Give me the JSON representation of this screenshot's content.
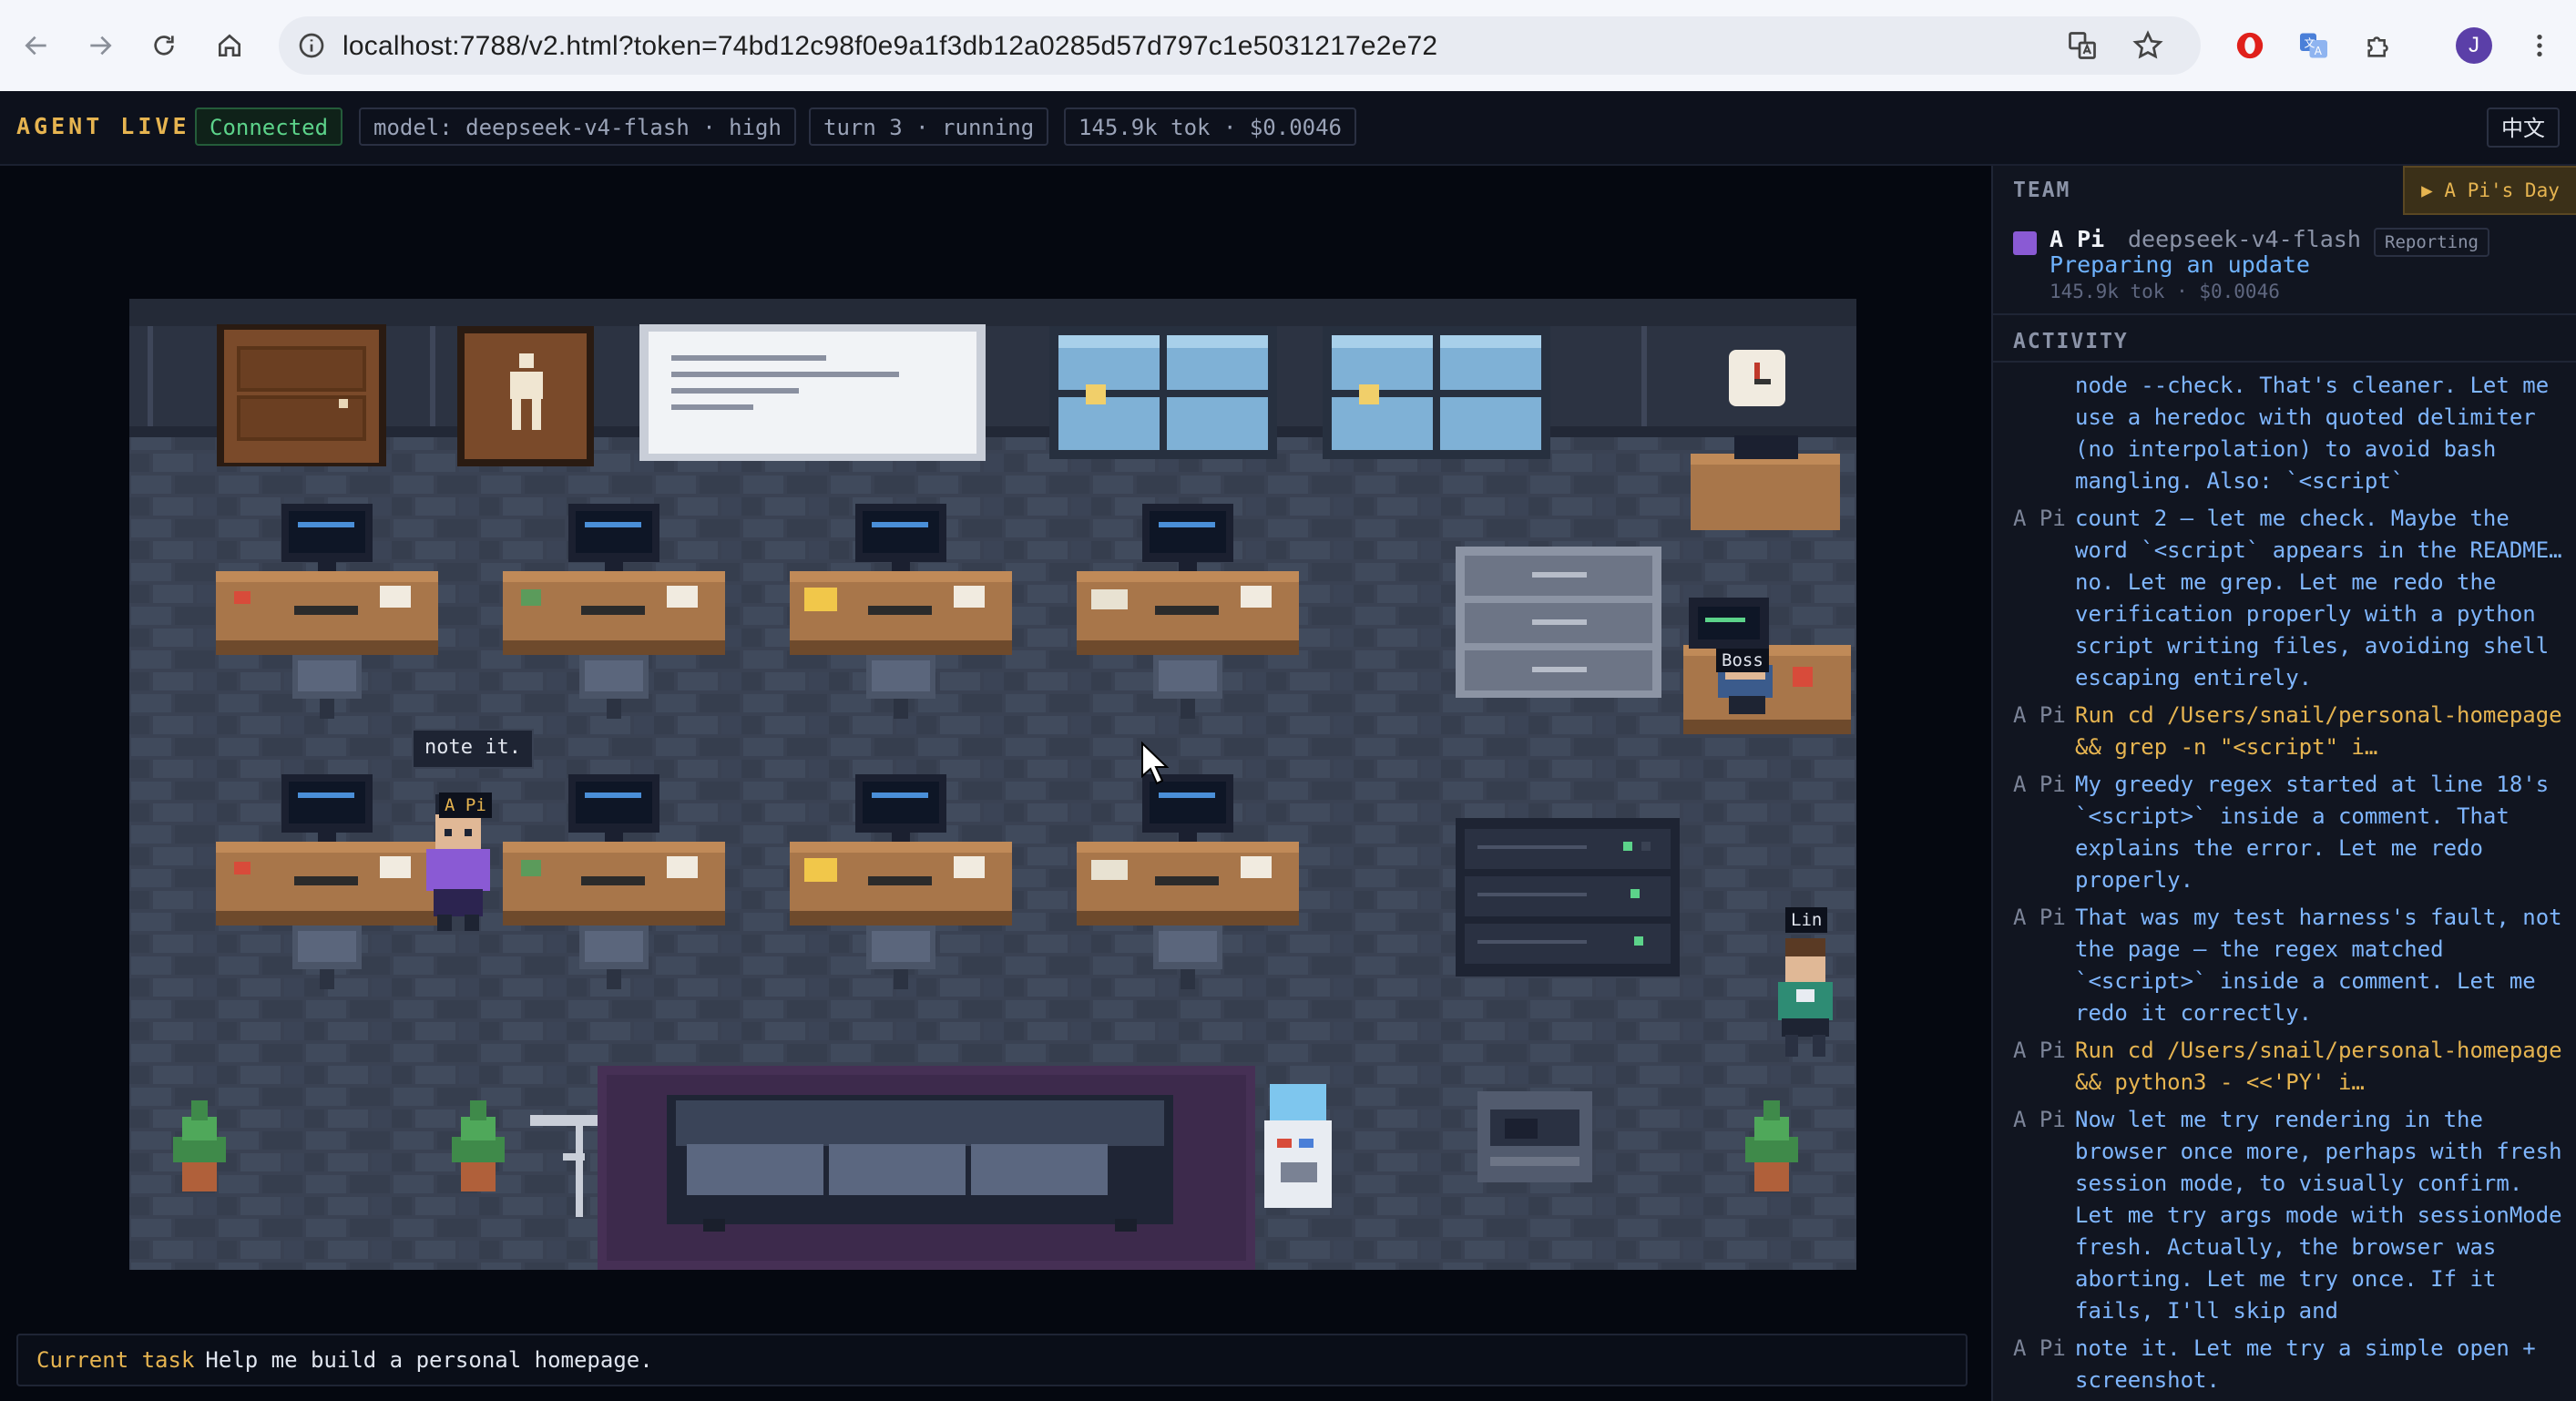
{
  "browser": {
    "url": "localhost:7788/v2.html?token=74bd12c98f0e9a1f3db12a0285d57d797c1e5031217e2e72",
    "profile_initial": "J"
  },
  "status_bar": {
    "agent_label": "AGENT LIVE",
    "connection": "Connected",
    "model": "model: deepseek-v4-flash · high",
    "turn": "turn 3 · running",
    "tokens_cost": "145.9k tok · $0.0046",
    "language_toggle": "中文"
  },
  "scene": {
    "speech_bubble": "note it.",
    "characters": [
      {
        "name": "A Pi",
        "color": "#8a5ad4"
      },
      {
        "name": "Boss",
        "color": "#3b5b8c"
      },
      {
        "name": "Lin",
        "color": "#2e8c74"
      }
    ],
    "colors": {
      "floor": "#3a4253",
      "wall": "#2c3342",
      "desk": "#a8764a",
      "rug": "#463055"
    }
  },
  "current_task": {
    "label": "Current task",
    "text": "Help me build a personal homepage."
  },
  "team": {
    "heading": "TEAM",
    "day_button": "▶ A Pi's Day",
    "member": {
      "name": "A Pi",
      "model": "deepseek-v4-flash",
      "status": "Reporting",
      "activity": "Preparing an update",
      "stats": "145.9k tok · $0.0046"
    }
  },
  "activity": {
    "heading": "ACTIVITY",
    "entries": [
      {
        "who": "",
        "kind": "say",
        "text": "node --check. That's cleaner. Let me\nuse a heredoc with quoted delimiter\n(no interpolation) to avoid bash\nmangling. Also: `<script`"
      },
      {
        "who": "A Pi",
        "kind": "say",
        "text": "count 2 — let me check. Maybe the\nword `<script` appears in the README…\nno. Let me grep. Let me redo the\nverification properly with a python\nscript writing files, avoiding shell\nescaping entirely."
      },
      {
        "who": "A Pi",
        "kind": "run",
        "text": "Run cd /Users/snail/personal-homepage\n&& grep -n \"<script\" i…"
      },
      {
        "who": "A Pi",
        "kind": "say",
        "text": "My greedy regex started at line 18's\n`<script>` inside a comment. That\nexplains the error. Let me redo\nproperly."
      },
      {
        "who": "A Pi",
        "kind": "say",
        "text": "That was my test harness's fault, not\nthe page — the regex matched\n`<script>` inside a comment. Let me\nredo it correctly."
      },
      {
        "who": "A Pi",
        "kind": "run",
        "text": "Run cd /Users/snail/personal-homepage\n&& python3 - <<'PY' i…"
      },
      {
        "who": "A Pi",
        "kind": "say",
        "text": "Now let me try rendering in the\nbrowser once more, perhaps with fresh\nsession mode, to visually confirm.\nLet me try args mode with sessionMode\nfresh. Actually, the browser was\naborting. Let me try once. If it\nfails, I'll skip and"
      },
      {
        "who": "A Pi",
        "kind": "say",
        "text": "note it. Let me try a simple open +\nscreenshot."
      }
    ]
  }
}
